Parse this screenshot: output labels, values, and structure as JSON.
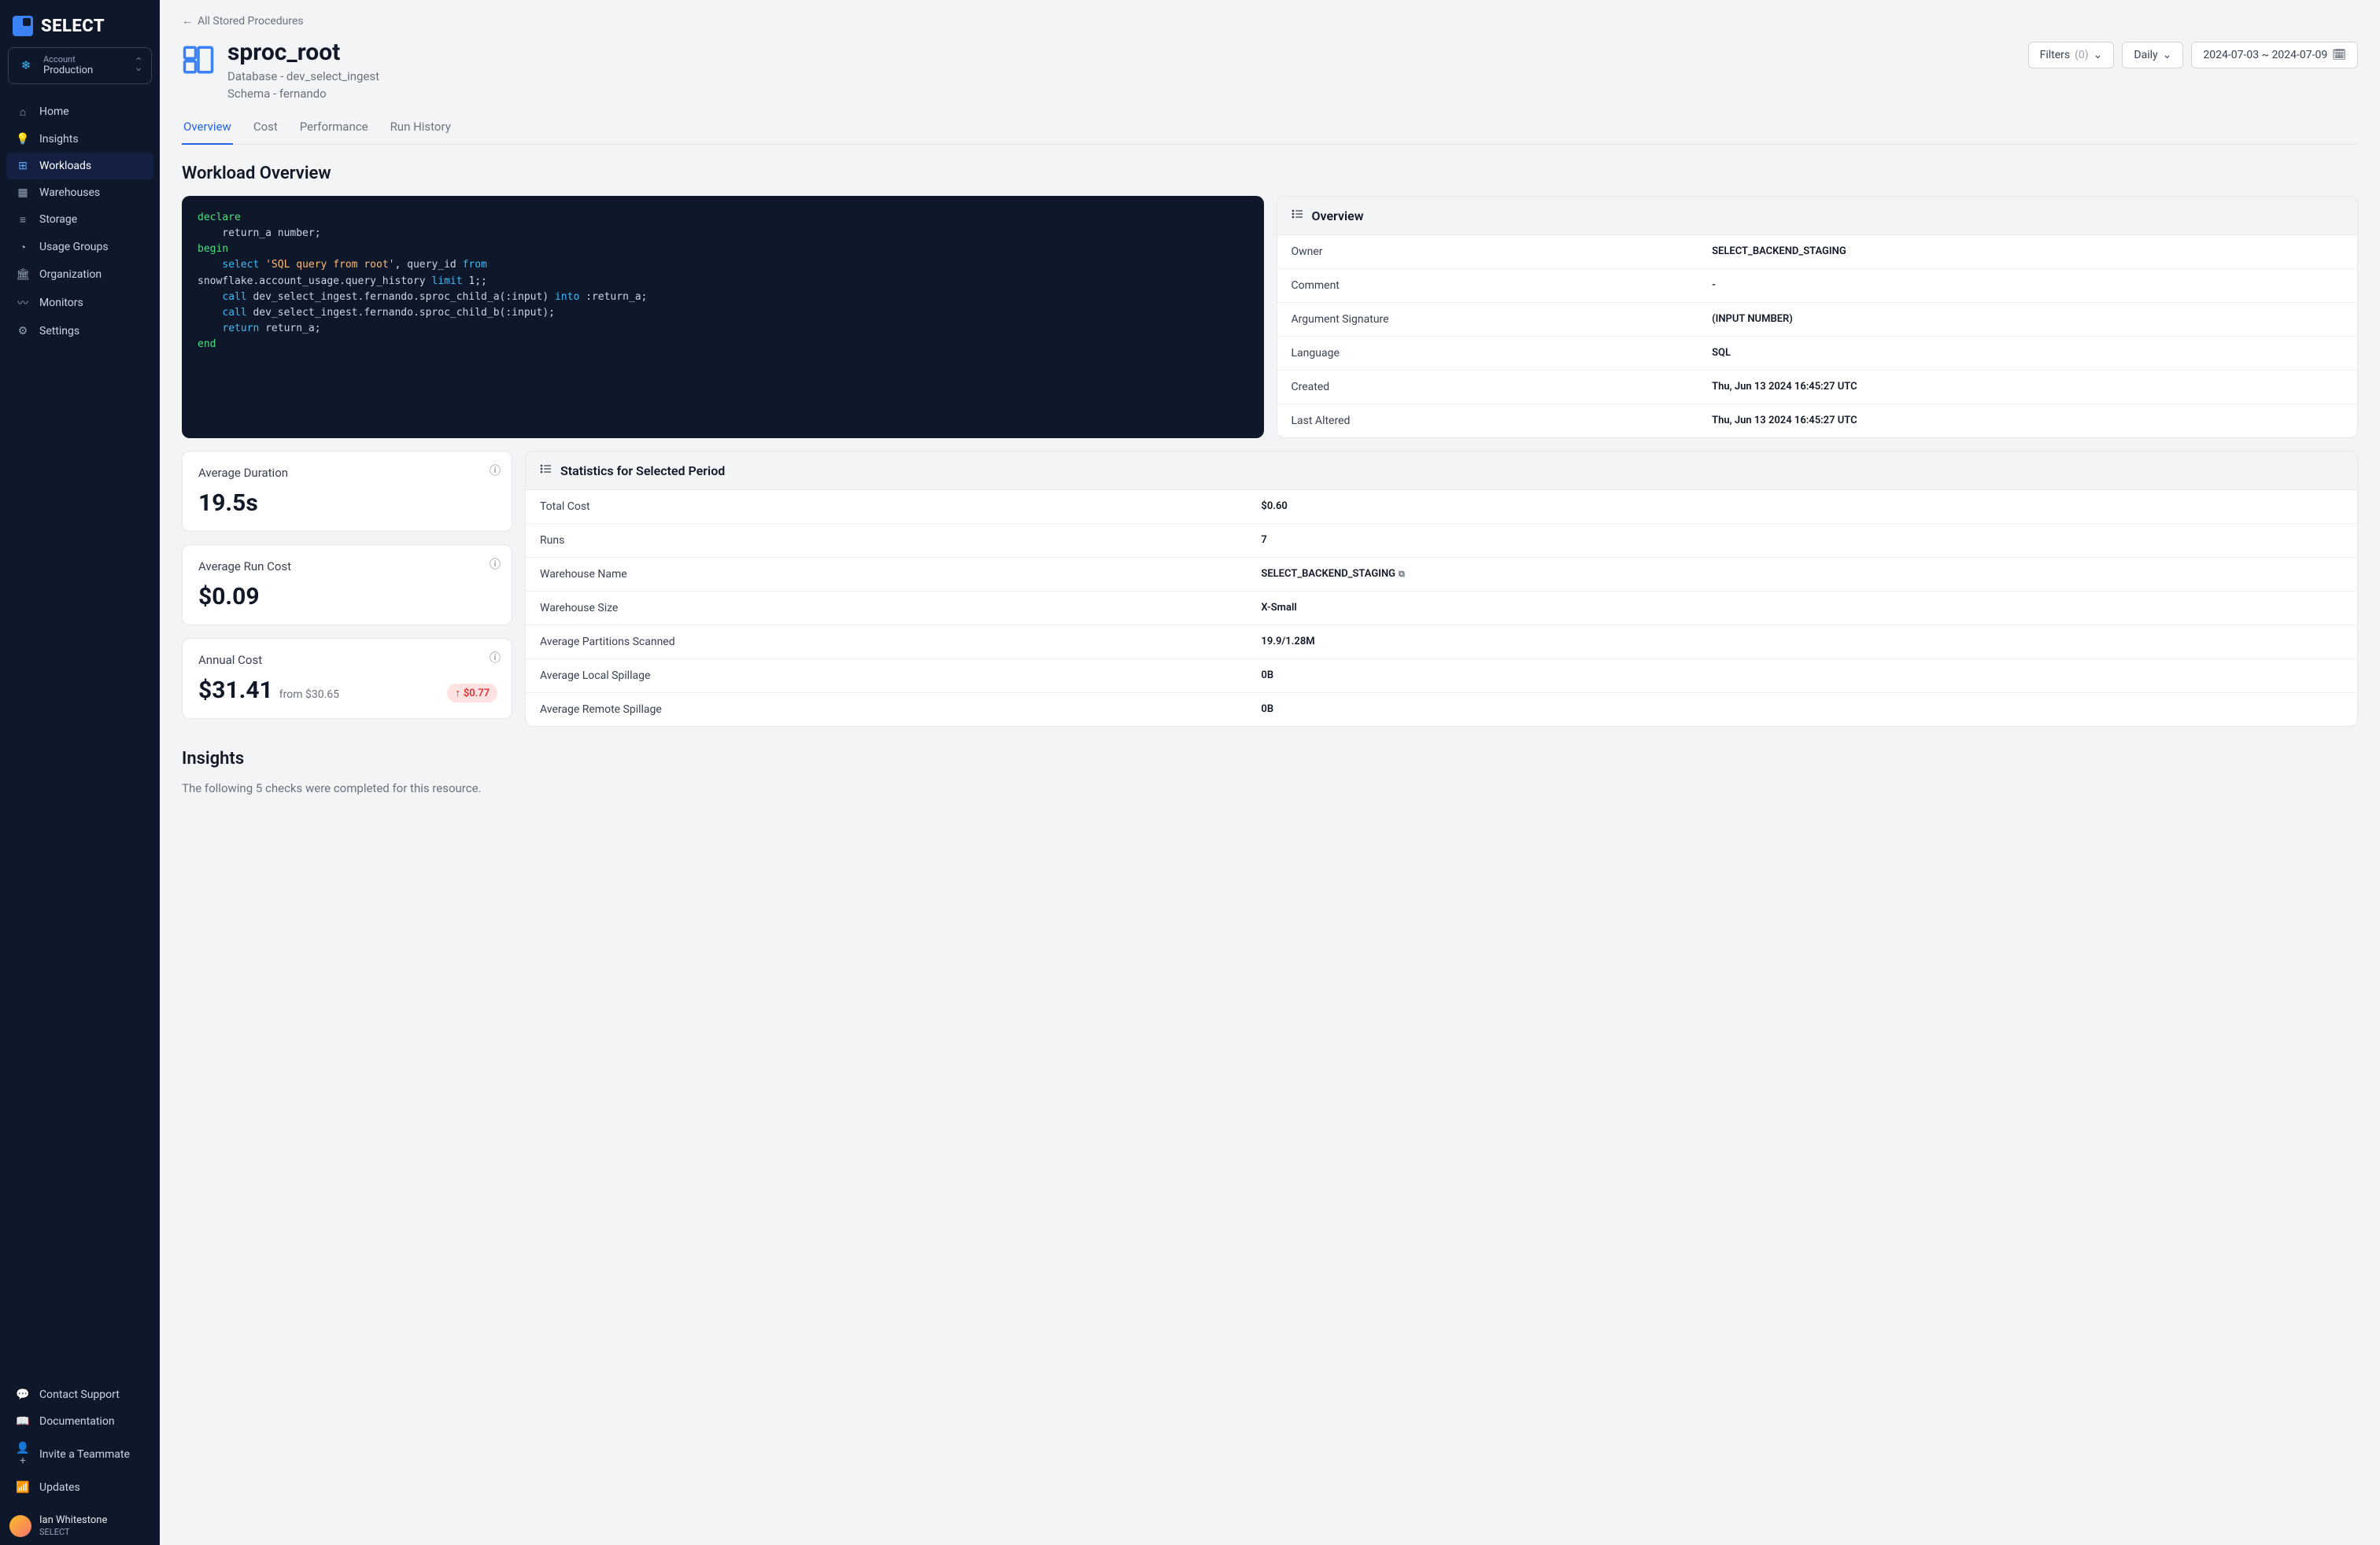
{
  "brand": "SELECT",
  "account": {
    "label": "Account",
    "name": "Production"
  },
  "nav": [
    {
      "icon": "⌂",
      "label": "Home"
    },
    {
      "icon": "💡",
      "label": "Insights"
    },
    {
      "icon": "⊞",
      "label": "Workloads",
      "active": true
    },
    {
      "icon": "▦",
      "label": "Warehouses"
    },
    {
      "icon": "≡",
      "label": "Storage"
    },
    {
      "icon": "◔",
      "label": "Usage Groups"
    },
    {
      "icon": "🏛",
      "label": "Organization"
    },
    {
      "icon": "〰",
      "label": "Monitors"
    },
    {
      "icon": "⚙",
      "label": "Settings"
    }
  ],
  "navBottom": [
    {
      "icon": "💬",
      "label": "Contact Support"
    },
    {
      "icon": "📖",
      "label": "Documentation"
    },
    {
      "icon": "👤+",
      "label": "Invite a Teammate"
    },
    {
      "icon": "📶",
      "label": "Updates"
    }
  ],
  "user": {
    "name": "Ian Whitestone",
    "org": "SELECT"
  },
  "breadcrumb": "All Stored Procedures",
  "page": {
    "title": "sproc_root",
    "sub1": "Database - dev_select_ingest",
    "sub2": "Schema - fernando"
  },
  "controls": {
    "filters": "Filters",
    "filtersCount": "(0)",
    "granularity": "Daily",
    "daterange": "2024-07-03 ~ 2024-07-09"
  },
  "tabs": [
    "Overview",
    "Cost",
    "Performance",
    "Run History"
  ],
  "sectionTitle": "Workload Overview",
  "overviewPanel": {
    "title": "Overview",
    "rows": [
      {
        "k": "Owner",
        "v": "SELECT_BACKEND_STAGING"
      },
      {
        "k": "Comment",
        "v": "-"
      },
      {
        "k": "Argument Signature",
        "v": "(INPUT NUMBER)"
      },
      {
        "k": "Language",
        "v": "SQL"
      },
      {
        "k": "Created",
        "v": "Thu, Jun 13 2024 16:45:27 UTC"
      },
      {
        "k": "Last Altered",
        "v": "Thu, Jun 13 2024 16:45:27 UTC"
      }
    ]
  },
  "statsCards": [
    {
      "label": "Average Duration",
      "value": "19.5s"
    },
    {
      "label": "Average Run Cost",
      "value": "$0.09"
    },
    {
      "label": "Annual Cost",
      "value": "$31.41",
      "sub": "from $30.65",
      "badge": "$0.77"
    }
  ],
  "statsPanel": {
    "title": "Statistics for Selected Period",
    "rows": [
      {
        "k": "Total Cost",
        "v": "$0.60"
      },
      {
        "k": "Runs",
        "v": "7"
      },
      {
        "k": "Warehouse Name",
        "v": "SELECT_BACKEND_STAGING",
        "ext": true
      },
      {
        "k": "Warehouse Size",
        "v": "X-Small"
      },
      {
        "k": "Average Partitions Scanned",
        "v": "19.9/1.28M"
      },
      {
        "k": "Average Local Spillage",
        "v": "0B"
      },
      {
        "k": "Average Remote Spillage",
        "v": "0B"
      }
    ]
  },
  "insights": {
    "title": "Insights",
    "sub": "The following 5 checks were completed for this resource."
  }
}
